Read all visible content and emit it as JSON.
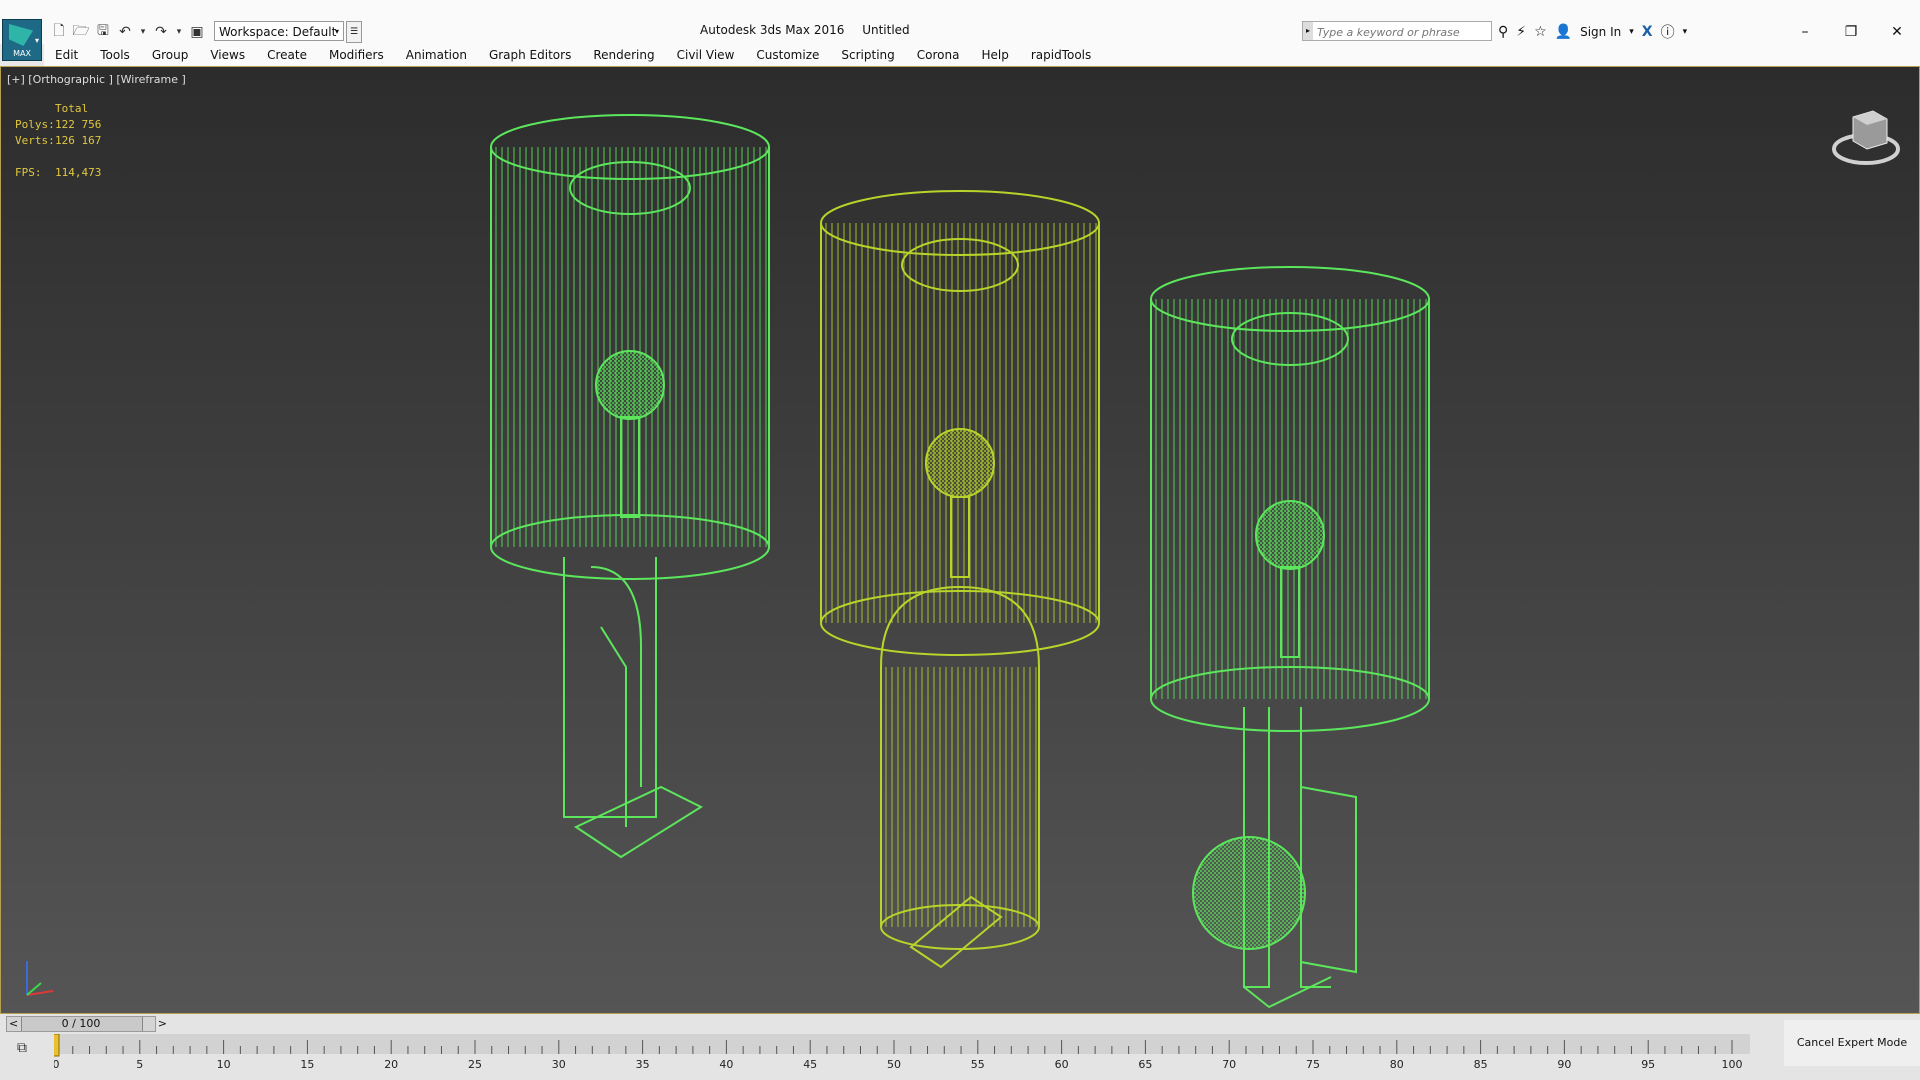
{
  "app": {
    "logo_text": "MAX",
    "title": "Autodesk 3ds Max 2016",
    "doc": "Untitled",
    "workspace": "Workspace: Default"
  },
  "search": {
    "placeholder": "Type a keyword or phrase"
  },
  "account": {
    "signin": "Sign In"
  },
  "window_controls": {
    "minimize": "–",
    "restore": "❐",
    "close": "✕"
  },
  "menu": [
    "Edit",
    "Tools",
    "Group",
    "Views",
    "Create",
    "Modifiers",
    "Animation",
    "Graph Editors",
    "Rendering",
    "Civil View",
    "Customize",
    "Scripting",
    "Corona",
    "Help",
    "rapidTools"
  ],
  "viewport": {
    "label": "[+] [Orthographic ] [Wireframe ]",
    "stats": {
      "header": "Total",
      "polys_label": "Polys:",
      "polys": "122 756",
      "verts_label": "Verts:",
      "verts": "126 167",
      "fps_label": "FPS:",
      "fps": "114,473"
    },
    "wire_colors": {
      "green": "#5ce65c",
      "yellow": "#b8d42a"
    }
  },
  "timeline": {
    "frame": "0 / 100",
    "prev": "<",
    "next": ">",
    "ticks": [
      "0",
      "5",
      "10",
      "15",
      "20",
      "25",
      "30",
      "35",
      "40",
      "45",
      "50",
      "55",
      "60",
      "65",
      "70",
      "75",
      "80",
      "85",
      "90",
      "95",
      "100"
    ],
    "cancel_expert": "Cancel Expert Mode"
  }
}
